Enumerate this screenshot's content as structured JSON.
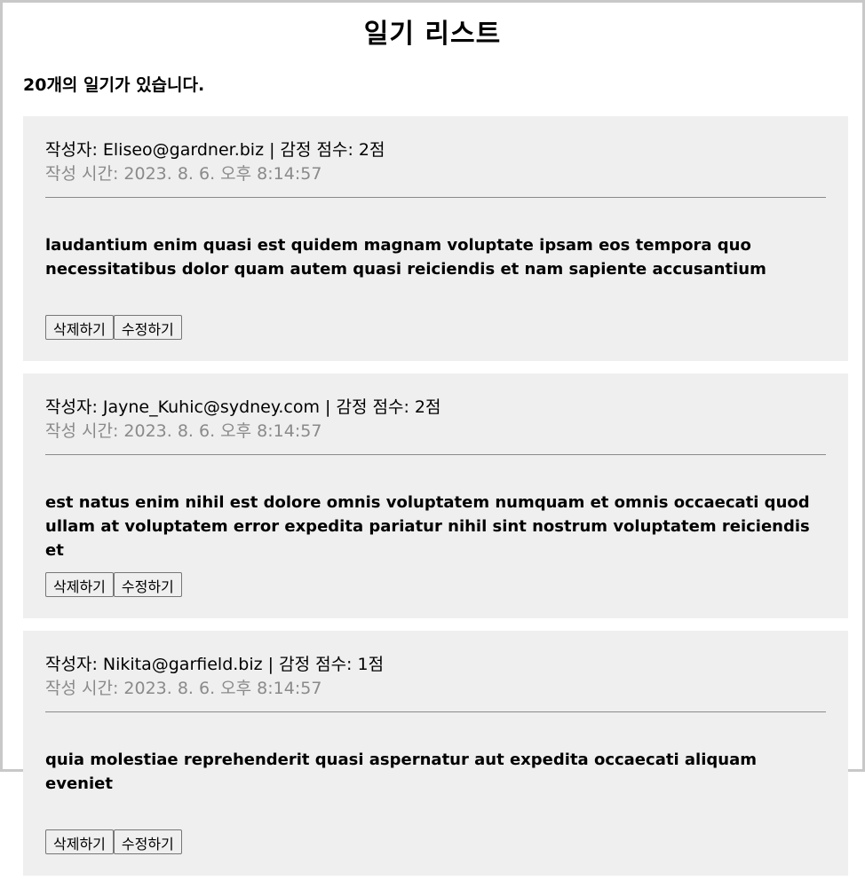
{
  "header": {
    "title": "일기 리스트",
    "count_text": "20개의 일기가 있습니다."
  },
  "diaries": [
    {
      "author_line": "작성자: Eliseo@gardner.biz | 감정 점수: 2점",
      "date_line": "작성 시간: 2023. 8. 6. 오후 8:14:57",
      "content": "laudantium enim quasi est quidem magnam voluptate ipsam eos tempora quo necessitatibus dolor quam autem quasi reiciendis et nam sapiente accusantium",
      "delete_label": "삭제하기",
      "edit_label": "수정하기"
    },
    {
      "author_line": "작성자: Jayne_Kuhic@sydney.com | 감정 점수: 2점",
      "date_line": "작성 시간: 2023. 8. 6. 오후 8:14:57",
      "content": "est natus enim nihil est dolore omnis voluptatem numquam et omnis occaecati quod ullam at voluptatem error expedita pariatur nihil sint nostrum voluptatem reiciendis et",
      "delete_label": "삭제하기",
      "edit_label": "수정하기"
    },
    {
      "author_line": "작성자: Nikita@garfield.biz | 감정 점수: 1점",
      "date_line": "작성 시간: 2023. 8. 6. 오후 8:14:57",
      "content": "quia molestiae reprehenderit quasi aspernatur aut expedita occaecati aliquam eveniet",
      "delete_label": "삭제하기",
      "edit_label": "수정하기"
    }
  ]
}
